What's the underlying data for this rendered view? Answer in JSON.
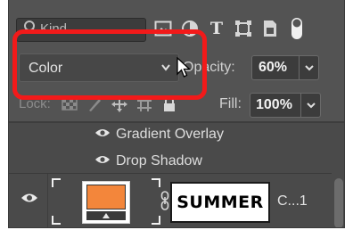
{
  "filter": {
    "kind_label": "Kind",
    "icons": [
      "image-filter-icon",
      "adjustment-filter-icon",
      "type-filter-icon",
      "shape-filter-icon",
      "smart-object-filter-icon",
      "filter-toggle-icon"
    ],
    "type_glyph": "T"
  },
  "blend": {
    "mode": "Color",
    "opacity_label": "Opacity:",
    "opacity_value": "60%"
  },
  "lock": {
    "label": "Lock:",
    "fill_label": "Fill:",
    "fill_value": "100%"
  },
  "effects": [
    {
      "label": "Gradient Overlay"
    },
    {
      "label": "Drop Shadow"
    }
  ],
  "layer": {
    "mask_text": "SUMMER",
    "name": "C...1"
  },
  "colors": {
    "highlight": "#f21a1a",
    "swatch": "#f3863b",
    "panel": "#535353"
  }
}
